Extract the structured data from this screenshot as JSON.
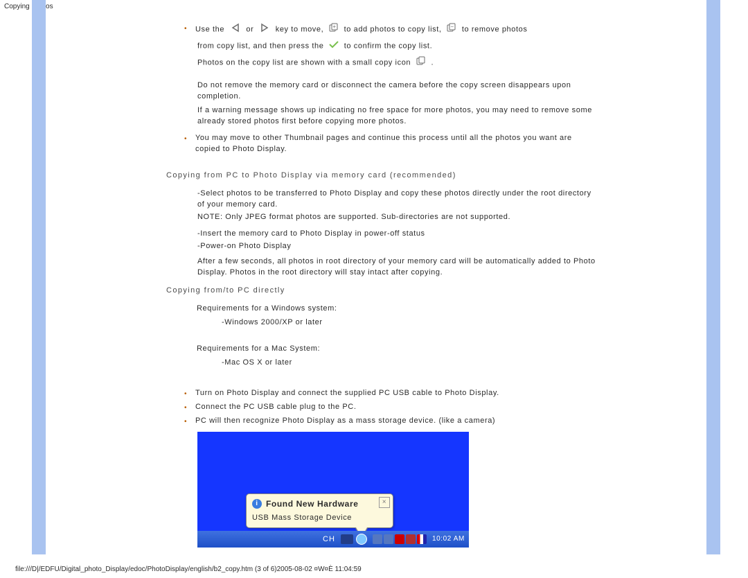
{
  "header_title": "Copying Photos",
  "footer_path": "file:///D|/EDFU/Digital_photo_Display/edoc/PhotoDisplay/english/b2_copy.htm (3 of 6)2005-08-02 ¤W¤È 11:04:59",
  "line1": {
    "a": "Use the ",
    "b": " or ",
    "c": " key to move, ",
    "d": " to add photos to copy list, ",
    "e": " to remove photos"
  },
  "line2_a": "from copy list, and then press the ",
  "line2_b": " to confirm the copy list.",
  "line3_a": "Photos on the copy list are shown with a small copy icon ",
  "line3_b": ".",
  "warn1": "Do not remove the memory card or disconnect the camera before the copy screen disappears upon completion.",
  "warn2": "If a warning message shows up indicating no free space for more photos, you may need to remove some already stored photos first before copying more photos.",
  "bullet_move": "You may move to other Thumbnail pages and continue this process until all the photos you want are copied to Photo Display.",
  "h_memcard": "Copying from PC to Photo Display via memory card (recommended)",
  "mem1": "-Select photos to be transferred to Photo Display and copy these photos directly under the root directory of your memory card.",
  "mem2": "NOTE: Only JPEG format photos are supported. Sub-directories are not supported.",
  "mem3": "-Insert the memory card to Photo Display in power-off status",
  "mem4": "-Power-on Photo Display",
  "mem5": "After a few seconds, all photos in root directory of your memory card will be automatically added to Photo Display. Photos in the root directory will stay intact after copying.",
  "h_pc": "Copying from/to PC directly",
  "req_win": "Requirements for a Windows system:",
  "req_win_1": "-Windows 2000/XP or later",
  "req_mac": "Requirements for a Mac System:",
  "req_mac_1": "-Mac OS X or later",
  "pc_b1": "Turn on Photo Display and connect the supplied PC USB cable to Photo Display.",
  "pc_b2": "Connect the PC USB cable plug to the PC.",
  "pc_b3": "PC will then recognize Photo Display as a mass storage device. (like a camera)",
  "balloon": {
    "title": "Found New Hardware",
    "sub": "USB Mass Storage Device"
  },
  "taskbar": {
    "ch": "CH",
    "clock": "10:02 AM"
  }
}
